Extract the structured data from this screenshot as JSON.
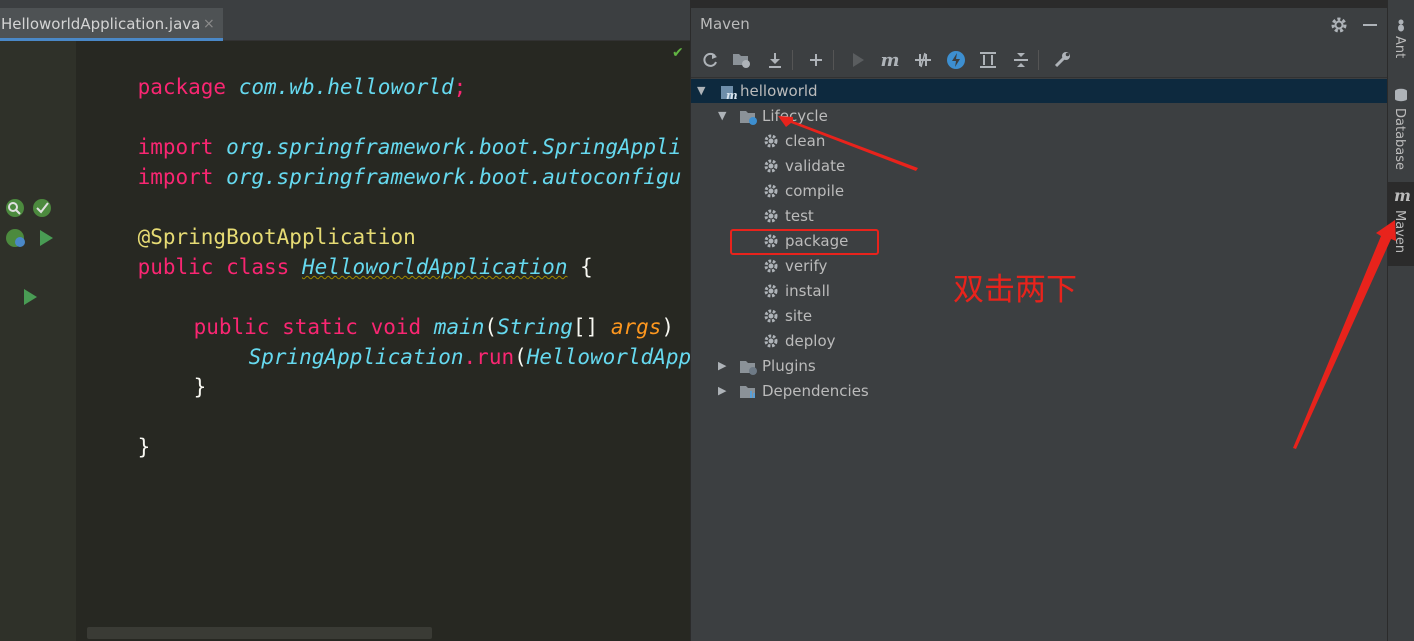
{
  "editor": {
    "tab_title": "HelloworldApplication.java",
    "tab_close": "×",
    "lines": {
      "l1_kw": "package ",
      "l1_ns": "com.wb.helloworld",
      "l1_end": ";",
      "l2_kw": "import ",
      "l2_ns": "org.springframework.boot.SpringAppli",
      "l3_kw": "import ",
      "l3_ns": "org.springframework.boot.autoconfigu",
      "l4_ann": "@SpringBootApplication",
      "l5_kw": "public class ",
      "l5_cls": "HelloworldApplication",
      "l5_end": " {",
      "l6_kw": "public static void ",
      "l6_method": "main",
      "l6_paren": "(",
      "l6_type": "String",
      "l6_brackets": "[] ",
      "l6_arg": "args",
      "l6_end": ") ",
      "l7_cls": "SpringApplication",
      "l7_dot": ".",
      "l7_method": "run",
      "l7_paren": "(",
      "l7_arg": "HelloworldApp",
      "l8": "}",
      "l9": "}"
    }
  },
  "maven": {
    "title": "Maven",
    "tree": {
      "root": "helloworld",
      "lifecycle": "Lifecycle",
      "phases": [
        "clean",
        "validate",
        "compile",
        "test",
        "package",
        "verify",
        "install",
        "site",
        "deploy"
      ],
      "plugins": "Plugins",
      "dependencies": "Dependencies"
    }
  },
  "tool_strip": {
    "ant": "Ant",
    "database": "Database",
    "maven": "Maven"
  },
  "annotation": {
    "text": "双击两下",
    "color": "#e8231c"
  },
  "colors": {
    "keyword": "#f92672",
    "type": "#66d9ef",
    "annotation": "#e6db74",
    "argument": "#fd971f",
    "selection": "#0d293e"
  }
}
